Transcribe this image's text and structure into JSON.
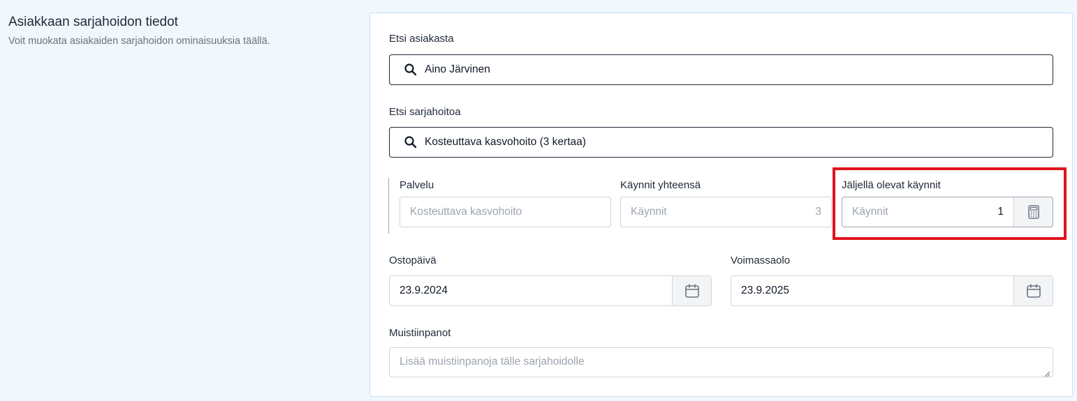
{
  "section": {
    "title": "Asiakkaan sarjahoidon tiedot",
    "description": "Voit muokata asiakaiden sarjahoidon ominaisuuksia täällä."
  },
  "customer_search": {
    "label": "Etsi asiakasta",
    "value": "Aino Järvinen",
    "icon": "search-icon"
  },
  "series_search": {
    "label": "Etsi sarjahoitoa",
    "value": "Kosteuttava kasvohoito (3 kertaa)",
    "icon": "search-icon"
  },
  "service": {
    "label": "Palvelu",
    "placeholder": "Kosteuttava kasvohoito"
  },
  "visits_total": {
    "label": "Käynnit yhteensä",
    "placeholder": "Käynnit",
    "value": "3"
  },
  "visits_remaining": {
    "label": "Jäljellä olevat käynnit",
    "placeholder": "Käynnit",
    "value": "1",
    "icon": "calculator-icon"
  },
  "purchase_date": {
    "label": "Ostopäivä",
    "value": "23.9.2024",
    "icon": "calendar-icon"
  },
  "validity": {
    "label": "Voimassaolo",
    "value": "23.9.2025",
    "icon": "calendar-icon"
  },
  "notes": {
    "label": "Muistiinpanot",
    "placeholder": "Lisää muistiinpanoja tälle sarjahoidolle"
  },
  "colors": {
    "background": "#f0f7fd",
    "highlight": "#e0141e",
    "border": "#d1d5db"
  }
}
